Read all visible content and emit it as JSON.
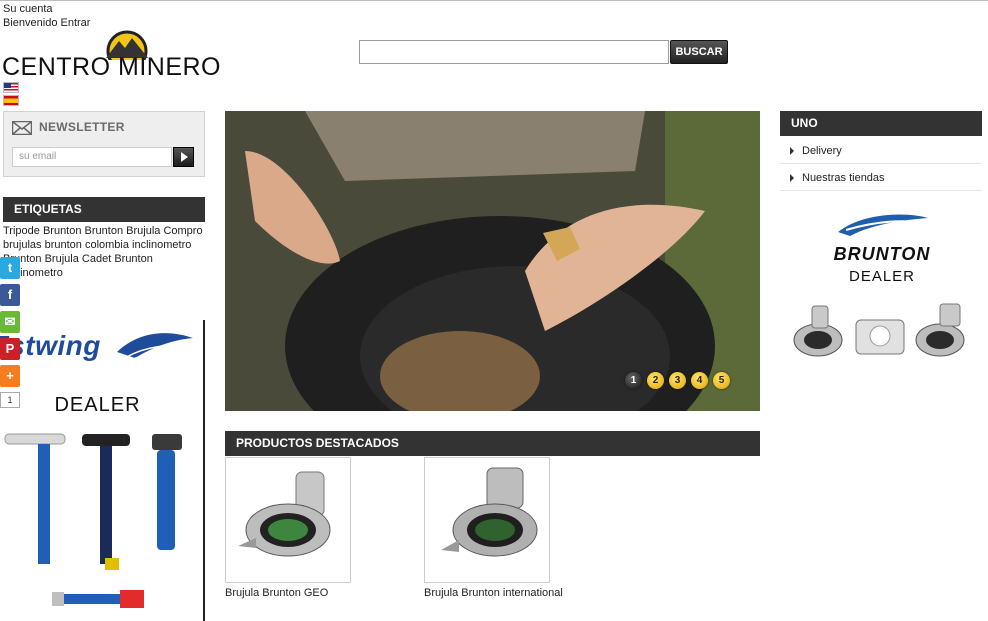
{
  "header": {
    "account_label": "Su cuenta",
    "welcome_text": "Bienvenido",
    "login_link": "Entrar",
    "logo_text": "CENTRO MINERO"
  },
  "search": {
    "placeholder": "",
    "button_label": "BUSCAR"
  },
  "newsletter": {
    "title": "NEWSLETTER",
    "email_placeholder": "su email"
  },
  "tags": {
    "title": "ETIQUETAS",
    "items": [
      "Tripode Brunton",
      "Brunton",
      "Brujula",
      "Compro",
      "brujulas brunton",
      "colombia",
      "inclinometro",
      "Brunton",
      "Brujula Cadet",
      "Brunton",
      "Inclinometro"
    ]
  },
  "estwing_banner": {
    "brand_text": "Estwing",
    "dealer_text": "DEALER"
  },
  "social": {
    "share_count": "1"
  },
  "slider": {
    "dots": [
      "1",
      "2",
      "3",
      "4",
      "5"
    ],
    "active_index": 0
  },
  "featured": {
    "title": "PRODUCTOS DESTACADOS",
    "products": [
      {
        "name": "Brujula Brunton GEO"
      },
      {
        "name": "Brujula Brunton international"
      }
    ]
  },
  "right_menu": {
    "title": "UNO",
    "items": [
      {
        "label": "Delivery"
      },
      {
        "label": "Nuestras tiendas"
      }
    ]
  },
  "brunton_banner": {
    "brand_text": "BRUNTON",
    "dealer_text": "DEALER"
  },
  "colors": {
    "bar_bg": "#333333",
    "estwing_blue": "#1e4c9a",
    "brunton_blue": "#1d5fae",
    "dot_yellow": "#f2c300"
  }
}
